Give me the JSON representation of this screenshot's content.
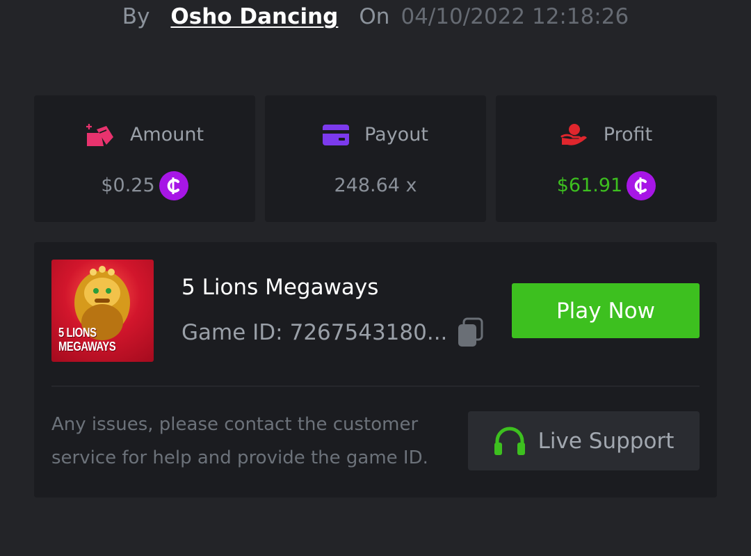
{
  "header": {
    "by_label": "By",
    "username": "Osho Dancing",
    "on_label": "On",
    "datetime": "04/10/2022 12:18:26"
  },
  "stats": [
    {
      "label": "Amount",
      "value": "$0.25",
      "icon": "bet-chips-icon",
      "currency_icon": "coin-icon"
    },
    {
      "label": "Payout",
      "value": "248.64 x",
      "icon": "card-icon"
    },
    {
      "label": "Profit",
      "value": "$61.91",
      "icon": "hand-money-icon",
      "currency_icon": "coin-icon"
    }
  ],
  "game": {
    "title": "5 Lions Megaways",
    "thumbnail_text_line1": "5 LIONS",
    "thumbnail_text_line2": "MEGAWAYS",
    "id_label": "Game ID:",
    "id_value": "7267543180...",
    "play_label": "Play Now"
  },
  "support": {
    "help_text": "Any issues, please contact the customer service for help and provide the game ID.",
    "button_label": "Live Support"
  },
  "colors": {
    "background": "#232428",
    "card": "#1b1c20",
    "accent_green": "#3dc01f",
    "coin_purple": "#a716e6",
    "amount_icon": "#e8336e",
    "payout_icon": "#7c3aed",
    "profit_icon": "#e0262d"
  }
}
